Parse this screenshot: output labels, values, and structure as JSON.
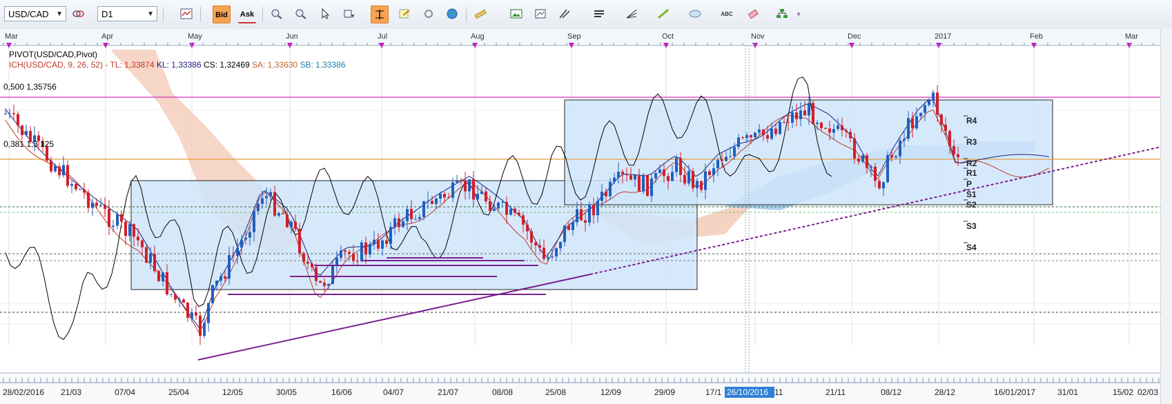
{
  "toolbar": {
    "symbol": "USD/CAD",
    "timeframe": "D1",
    "bid_label": "Bid",
    "ask_label": "Ask",
    "abc_label": "ABC"
  },
  "top_months": [
    "Mar",
    "Apr",
    "May",
    "Jun",
    "Jul",
    "Aug",
    "Sep",
    "Oct",
    "Nov",
    "Dec",
    "2017",
    "Feb",
    "Mar"
  ],
  "bottom_dates": [
    "28/02/2016",
    "21/03",
    "07/04",
    "25/04",
    "12/05",
    "30/05",
    "16/06",
    "04/07",
    "21/07",
    "08/08",
    "25/08",
    "12/09",
    "29/09",
    "17/1",
    "11",
    "21/11",
    "08/12",
    "28/12",
    "16/01/2017",
    "31/01",
    "15/02",
    "02/03"
  ],
  "crosshair_date": "26/10/2016",
  "legend": {
    "pivot": "PIVOT(USD/CAD,Pivot)",
    "ich": "ICH(USD/CAD, 9, 26, 52) -",
    "tl": "TL: 1,33874",
    "kl": "KL: 1,33386",
    "cs": "CS: 1,32469",
    "sa": "SA: 1,33630",
    "sb": "SB: 1,33386"
  },
  "fib_labels": {
    "f500": "0,500 1,35756",
    "f381": "0,381 1,3"
  },
  "fib_381_partial": "125",
  "pivot_labels": [
    "R4",
    "R3",
    "R2",
    "R1",
    "P",
    "S1",
    "S2",
    "S3",
    "S4"
  ],
  "colors": {
    "bull": "#1f5fbf",
    "bear": "#d21f2a",
    "box": "#cfe6fb",
    "fib500": "#d400b5",
    "fib381": "#e8901a",
    "trend": "#7a1f8f"
  }
}
